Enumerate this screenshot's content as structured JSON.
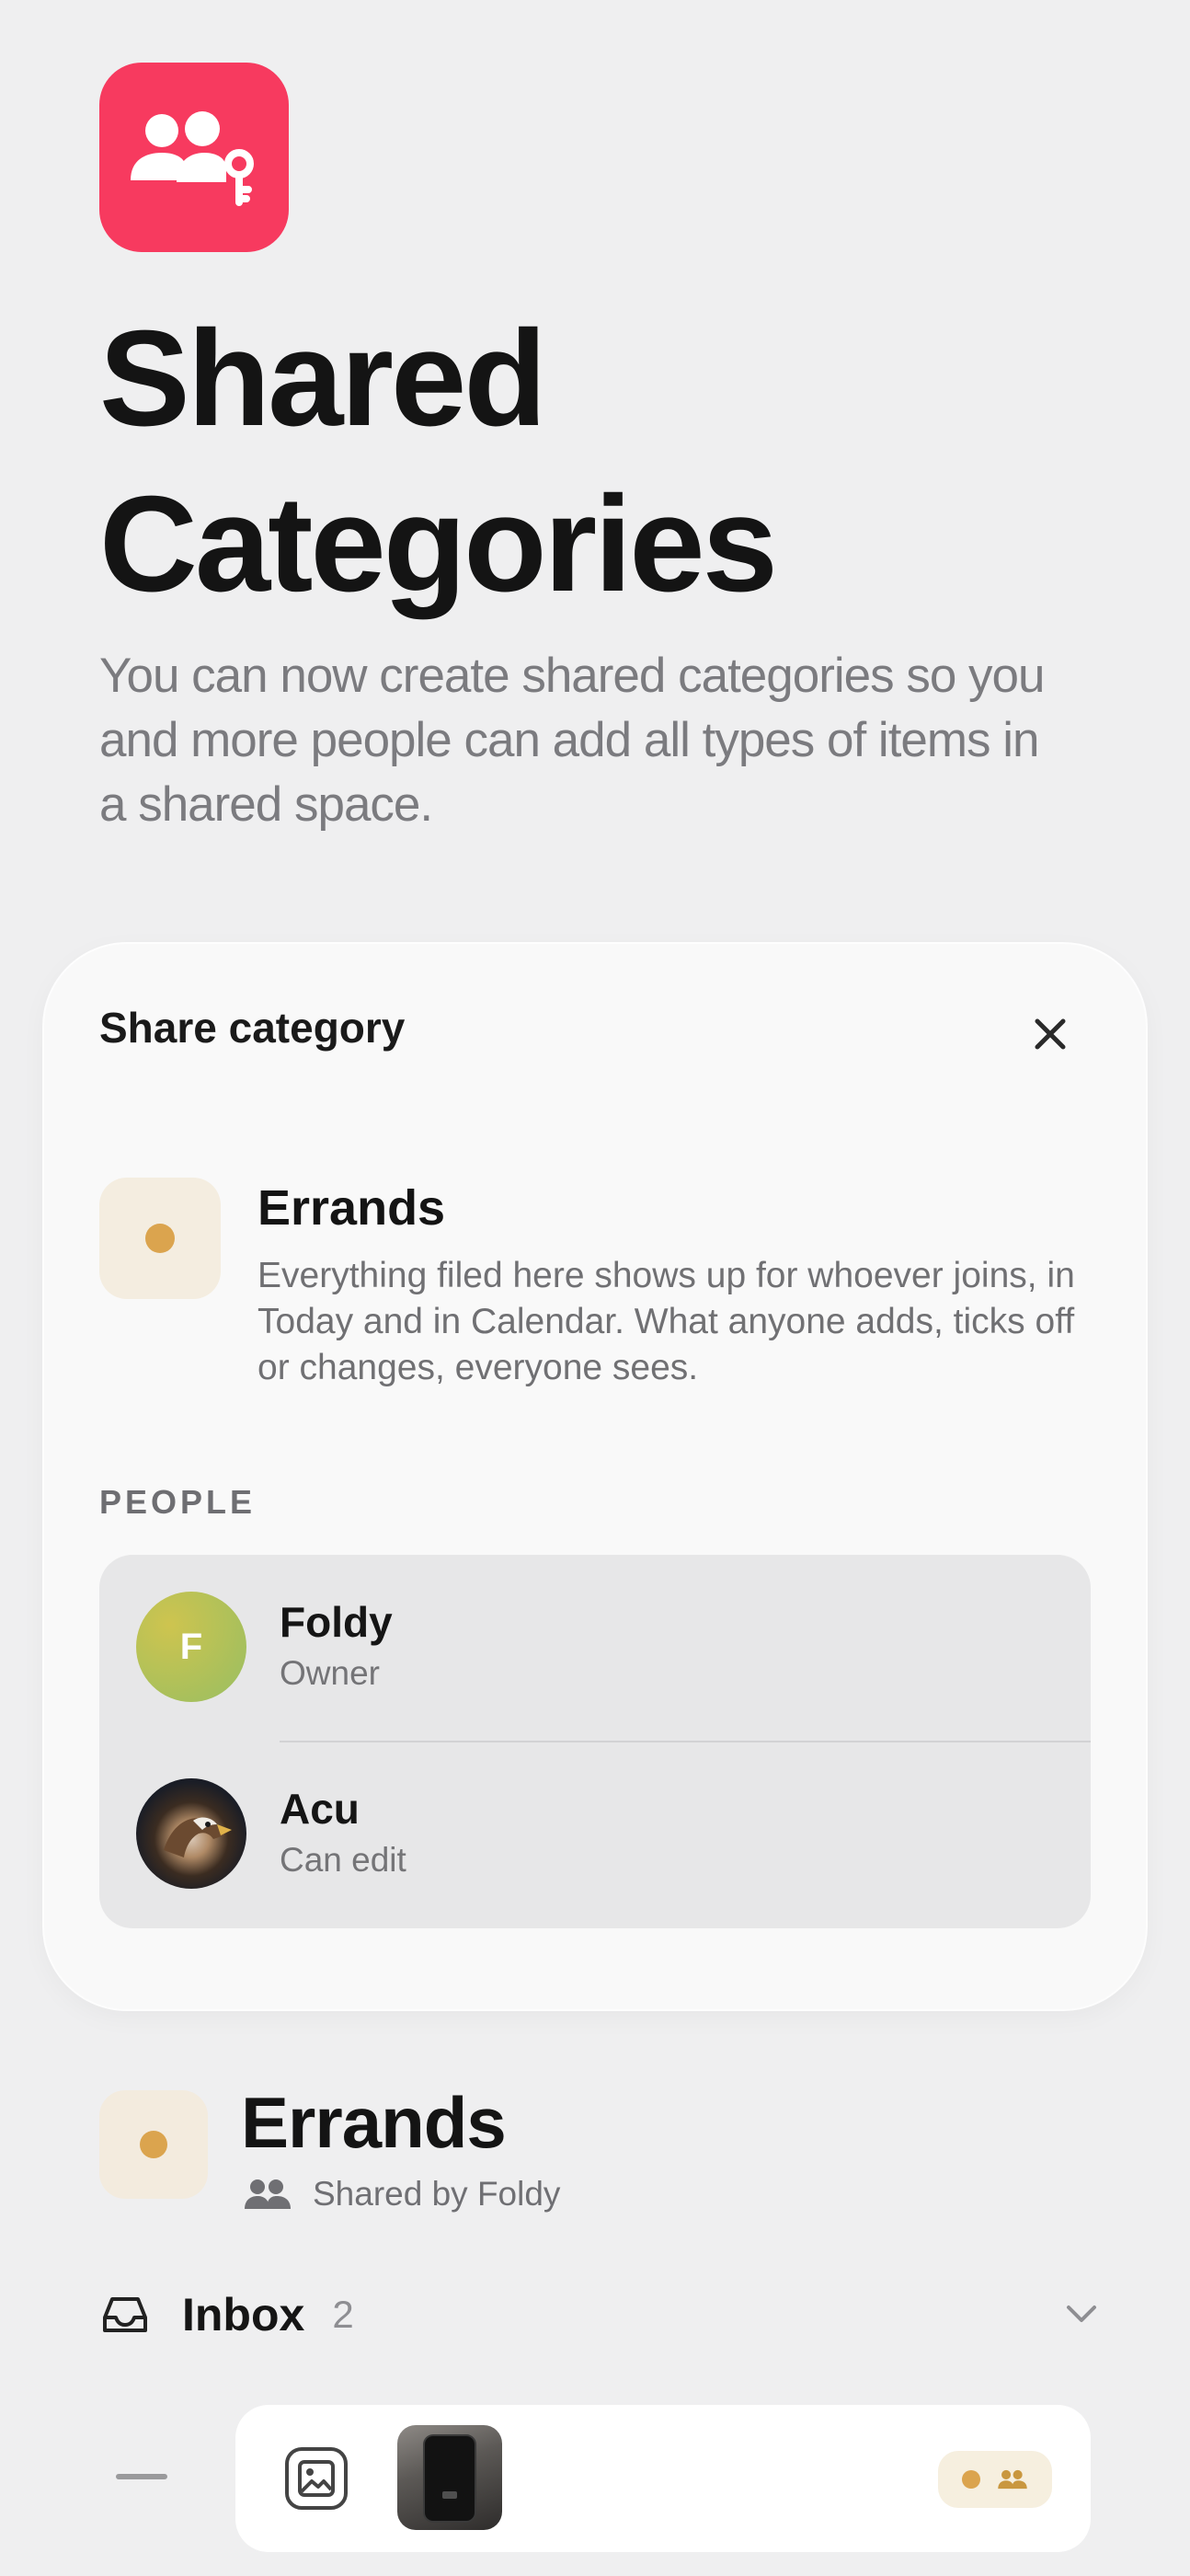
{
  "hero": {
    "icon": "shared-people-key-icon",
    "title_line1": "Shared",
    "title_line2": "Categories",
    "description": "You can now create shared categories so you and more people can add all types of items in a shared space."
  },
  "share_sheet": {
    "title": "Share category",
    "close_icon": "close-icon",
    "category": {
      "name": "Errands",
      "description": "Everything filed here shows up for whoever joins, in Today and in Calendar. What anyone adds, ticks off or changes, everyone sees.",
      "color": "#dba44e"
    },
    "people_label": "PEOPLE",
    "people": [
      {
        "initial": "F",
        "name": "Foldy",
        "role": "Owner"
      },
      {
        "initial": "",
        "name": "Acu",
        "role": "Can edit"
      }
    ]
  },
  "category_view": {
    "title": "Errands",
    "shared_by": "Shared by Foldy",
    "inbox_label": "Inbox",
    "inbox_count": "2"
  },
  "colors": {
    "accent_red": "#f73a5f",
    "category_gold": "#dba44e",
    "background": "#efeff0"
  }
}
